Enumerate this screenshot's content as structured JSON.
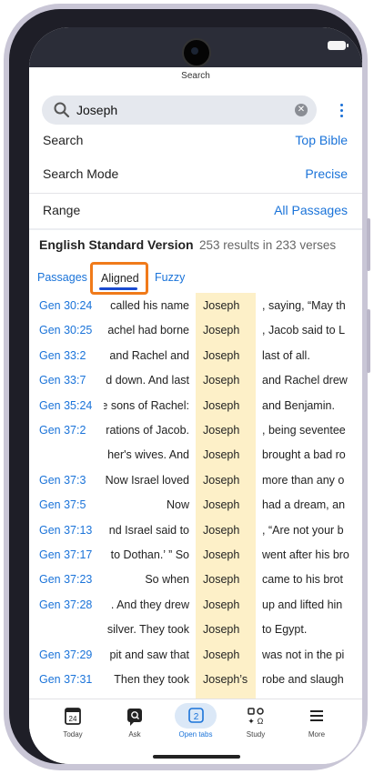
{
  "header": {
    "title": "Search"
  },
  "search": {
    "value": "Joseph"
  },
  "settings": [
    {
      "label": "Search",
      "value": "Top Bible"
    },
    {
      "label": "Search Mode",
      "value": "Precise"
    },
    {
      "label": "Range",
      "value": "All Passages"
    }
  ],
  "results": {
    "version": "English Standard Version",
    "count": "253 results in 233 verses"
  },
  "tabs": {
    "passages": "Passages",
    "aligned": "Aligned",
    "fuzzy": "Fuzzy",
    "active": "Aligned"
  },
  "rows": [
    {
      "ref": "Gen 30:24",
      "before": "called his name",
      "match": "Joseph",
      "after": ", saying, “May th"
    },
    {
      "ref": "Gen 30:25",
      "before": "achel had borne",
      "match": "Joseph",
      "after": ", Jacob said to L"
    },
    {
      "ref": "Gen 33:2",
      "before": "and Rachel and",
      "match": "Joseph",
      "after": "last of all."
    },
    {
      "ref": "Gen 33:7",
      "before": "d down. And last",
      "match": "Joseph",
      "after": "and Rachel drew"
    },
    {
      "ref": "Gen 35:24",
      "before": "e sons of Rachel:",
      "match": "Joseph",
      "after": "and Benjamin."
    },
    {
      "ref": "Gen 37:2",
      "before": "rations of Jacob.",
      "match": "Joseph",
      "after": ", being seventee"
    },
    {
      "ref": "",
      "before": "her's wives. And",
      "match": "Joseph",
      "after": "brought a bad ro"
    },
    {
      "ref": "Gen 37:3",
      "before": "Now Israel loved",
      "match": "Joseph",
      "after": "more than any o"
    },
    {
      "ref": "Gen 37:5",
      "before": "Now",
      "match": "Joseph",
      "after": "had a dream, an"
    },
    {
      "ref": "Gen 37:13",
      "before": "nd Israel said to",
      "match": "Joseph",
      "after": ", “Are not your b"
    },
    {
      "ref": "Gen 37:17",
      "before": "to Dothan.’ ” So",
      "match": "Joseph",
      "after": "went after his bro"
    },
    {
      "ref": "Gen 37:23",
      "before": "So when",
      "match": "Joseph",
      "after": "came to his brot"
    },
    {
      "ref": "Gen 37:28",
      "before": ". And they drew",
      "match": "Joseph",
      "after": "up and lifted hin"
    },
    {
      "ref": "",
      "before": "silver. They took",
      "match": "Joseph",
      "after": "to Egypt."
    },
    {
      "ref": "Gen 37:29",
      "before": "pit and saw that",
      "match": "Joseph",
      "after": "was not in the pi"
    },
    {
      "ref": "Gen 37:31",
      "before": "Then they took",
      "match": "Joseph’s",
      "after": "robe and slaugh"
    }
  ],
  "nav": [
    {
      "label": "Today",
      "icon": "calendar-icon",
      "badge": "24"
    },
    {
      "label": "Ask",
      "icon": "chat-search-icon"
    },
    {
      "label": "Open tabs",
      "icon": "tabs-icon",
      "badge": "2",
      "active": true
    },
    {
      "label": "Study",
      "icon": "study-icon"
    },
    {
      "label": "More",
      "icon": "menu-icon"
    }
  ],
  "colors": {
    "accent": "#1a73d9",
    "highlight": "#fdf0c8",
    "focus_ring": "#f07a1a"
  }
}
